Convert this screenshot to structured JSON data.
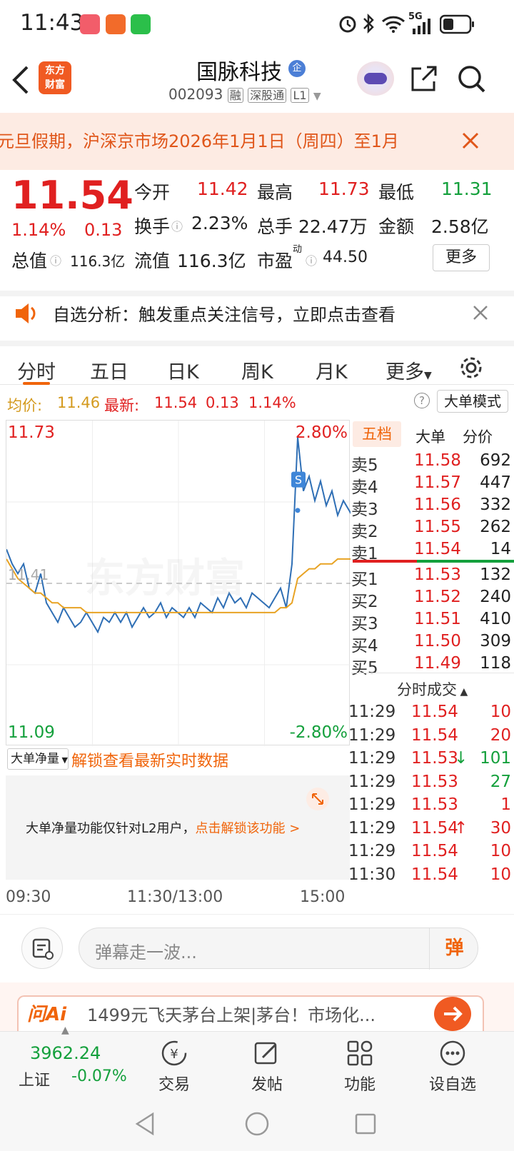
{
  "status": {
    "time": "11:43",
    "net": "5G"
  },
  "header": {
    "title": "国脉科技",
    "title_badge": "企",
    "logo_line1": "东方",
    "logo_line2": "财富",
    "code": "002093",
    "tag_margin": "融",
    "tag_connect": "深股通",
    "tag_level": "L1"
  },
  "banner": {
    "text": "元旦假期，沪深京市场2026年1月1日（周四）至1月"
  },
  "quote": {
    "price": "11.54",
    "pct": "1.14%",
    "chg": "0.13",
    "open_label": "今开",
    "open": "11.42",
    "high_label": "最高",
    "high": "11.73",
    "low_label": "最低",
    "low": "11.31",
    "turnover_label": "换手",
    "turnover": "2.23%",
    "volume_label": "总手",
    "volume": "22.47万",
    "amount_label": "金额",
    "amount": "2.58亿",
    "mcap_label": "总值",
    "mcap": "116.3亿",
    "float_label": "流值",
    "float": "116.3亿",
    "pe_label": "市盈",
    "pe_sup": "动",
    "pe": "44.50",
    "more": "更多"
  },
  "notice": {
    "text": "自选分析：触发重点关注信号，立即点击查看"
  },
  "tabs": [
    "分时",
    "五日",
    "日K",
    "周K",
    "月K",
    "更多"
  ],
  "summary": {
    "avg_label": "均价:",
    "avg": "11.46",
    "last_label": "最新:",
    "last": "11.54",
    "chg": "0.13",
    "pct": "1.14%",
    "mode": "大单模式"
  },
  "chart_data": {
    "type": "line",
    "y_range": [
      11.09,
      11.73
    ],
    "pct_range": [
      "2.80%",
      "-2.80%"
    ],
    "prev_close_label": "11.41",
    "labels": {
      "top_left": "11.73",
      "top_right": "2.80%",
      "bottom_left": "11.09",
      "bottom_right": "-2.80%"
    },
    "watermark": "东方财富",
    "marker": "S",
    "series": [
      {
        "kind": "price",
        "color": "#2f6fb5",
        "values": [
          11.48,
          11.45,
          11.43,
          11.45,
          11.4,
          11.39,
          11.43,
          11.37,
          11.35,
          11.33,
          11.36,
          11.34,
          11.32,
          11.33,
          11.35,
          11.33,
          11.31,
          11.34,
          11.33,
          11.35,
          11.33,
          11.35,
          11.32,
          11.34,
          11.36,
          11.34,
          11.35,
          11.37,
          11.34,
          11.36,
          11.35,
          11.34,
          11.36,
          11.34,
          11.37,
          11.36,
          11.35,
          11.38,
          11.36,
          11.39,
          11.37,
          11.38,
          11.36,
          11.39,
          11.38,
          11.37,
          11.36,
          11.38,
          11.4,
          11.36,
          11.45,
          11.71,
          11.6,
          11.63,
          11.58,
          11.62,
          11.57,
          11.6,
          11.55,
          11.58,
          11.56,
          11.54
        ]
      },
      {
        "kind": "avg",
        "color": "#e8a324",
        "values": [
          11.46,
          11.44,
          11.42,
          11.41,
          11.4,
          11.39,
          11.39,
          11.38,
          11.37,
          11.37,
          11.36,
          11.36,
          11.36,
          11.36,
          11.35,
          11.35,
          11.35,
          11.35,
          11.35,
          11.35,
          11.35,
          11.35,
          11.35,
          11.35,
          11.35,
          11.35,
          11.35,
          11.35,
          11.35,
          11.35,
          11.35,
          11.35,
          11.35,
          11.35,
          11.35,
          11.35,
          11.35,
          11.35,
          11.35,
          11.35,
          11.35,
          11.35,
          11.35,
          11.35,
          11.35,
          11.35,
          11.35,
          11.35,
          11.36,
          11.36,
          11.37,
          11.42,
          11.43,
          11.44,
          11.44,
          11.45,
          11.45,
          11.45,
          11.46,
          11.46,
          11.46,
          11.46
        ]
      }
    ],
    "x_labels": [
      "09:30",
      "11:30/13:00",
      "15:00"
    ]
  },
  "lower": {
    "selector": "大单净量",
    "unlock": "解锁查看最新实时数据",
    "note": "大单净量功能仅针对L2用户，",
    "note_link": "点击解锁该功能 >"
  },
  "book": {
    "tabs": [
      "五档",
      "大单",
      "分价"
    ],
    "asks": [
      [
        "卖5",
        "11.58",
        "692"
      ],
      [
        "卖4",
        "11.57",
        "447"
      ],
      [
        "卖3",
        "11.56",
        "332"
      ],
      [
        "卖2",
        "11.55",
        "262"
      ],
      [
        "卖1",
        "11.54",
        "14"
      ]
    ],
    "bids": [
      [
        "买1",
        "11.53",
        "132"
      ],
      [
        "买2",
        "11.52",
        "240"
      ],
      [
        "买3",
        "11.51",
        "410"
      ],
      [
        "买4",
        "11.50",
        "309"
      ],
      [
        "买5",
        "11.49",
        "118"
      ]
    ],
    "trades_title": "分时成交",
    "trades": [
      [
        "11:29",
        "11.54",
        "",
        "10",
        "red"
      ],
      [
        "11:29",
        "11.54",
        "",
        "20",
        "red"
      ],
      [
        "11:29",
        "11.53",
        "↓",
        "101",
        "green"
      ],
      [
        "11:29",
        "11.53",
        "",
        "27",
        "green"
      ],
      [
        "11:29",
        "11.53",
        "",
        "1",
        "red"
      ],
      [
        "11:29",
        "11.54",
        "↑",
        "30",
        "red"
      ],
      [
        "11:29",
        "11.54",
        "",
        "10",
        "red"
      ],
      [
        "11:30",
        "11.54",
        "",
        "10",
        "red"
      ]
    ]
  },
  "danmu": {
    "placeholder": "弹幕走一波...",
    "send": "弹"
  },
  "ai": {
    "brand": "问Ai",
    "text": "1499元飞天茅台上架|茅台！市场化..."
  },
  "bottom": {
    "index_value": "3962.24",
    "index_name": "上证",
    "index_pct": "-0.07%",
    "items": [
      "交易",
      "发帖",
      "功能",
      "设自选"
    ]
  }
}
